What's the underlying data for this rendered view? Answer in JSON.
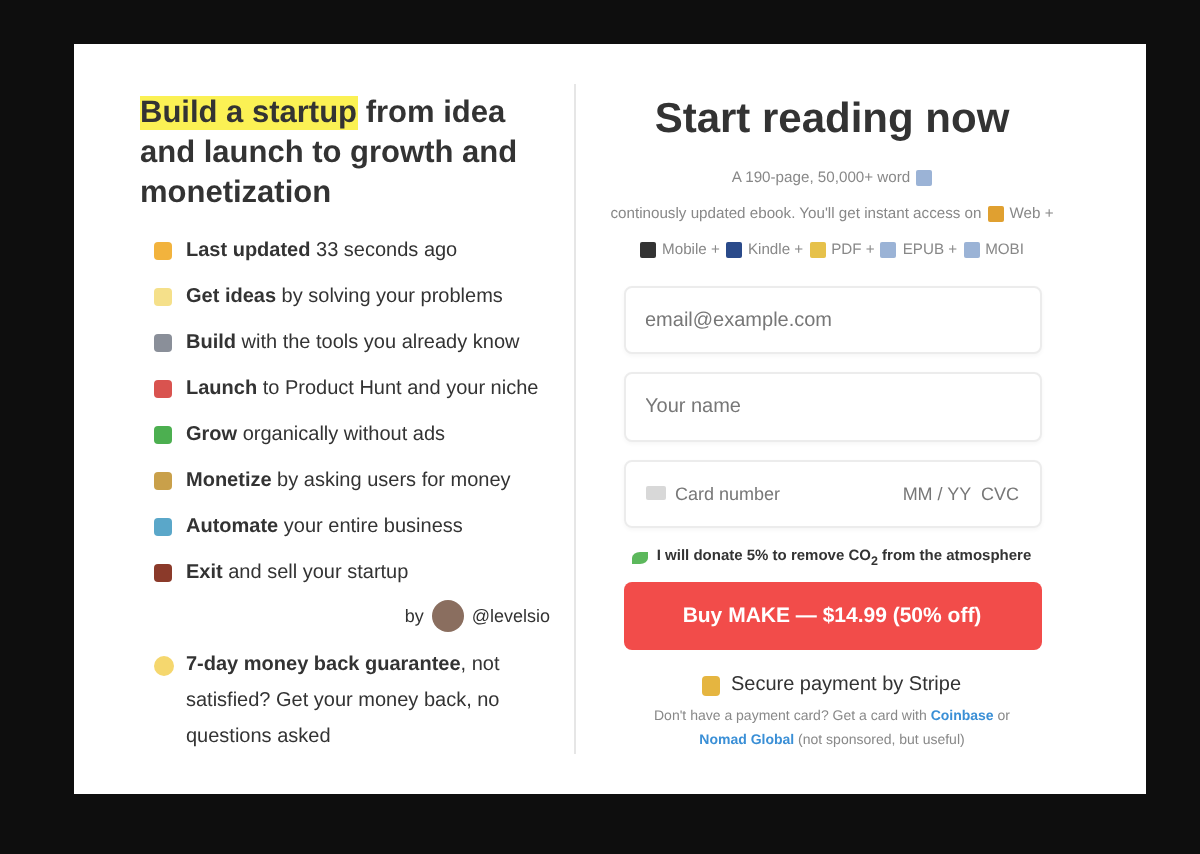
{
  "left": {
    "headline_highlight": "Build a startup",
    "headline_rest": "from idea and launch to growth and monetization",
    "features": [
      {
        "text": "**Last updated** 33 seconds ago"
      },
      {
        "text": "**Get ideas** by solving your problems"
      },
      {
        "text": "**Build** with the tools you already know"
      },
      {
        "text": "**Launch** to Product Hunt and your niche"
      },
      {
        "text": "**Grow** organically without ads"
      },
      {
        "text": "**Monetize** by asking users for money"
      },
      {
        "text": "**Automate** your entire business"
      },
      {
        "text": "**Exit** and sell your startup"
      }
    ],
    "byline": {
      "by": "by",
      "handle": "@levelsio"
    },
    "guarantee": "**7-day money back guarantee**, not satisfied? Get your money back, no questions asked"
  },
  "right": {
    "title": "Start reading now",
    "description": [
      "A 190-page, 50,000+ word",
      "continously updated ebook. You'll get instant access on",
      "Web +",
      "Mobile +",
      "Kindle +",
      "PDF +",
      "EPUB +",
      "MOBI"
    ],
    "email": {
      "placeholder": "email@example.com"
    },
    "name": {
      "placeholder": "Your name"
    },
    "card": {
      "placeholder": "Card number",
      "expiry_cvc": "MM / YY  CVC"
    },
    "donation": "I will donate 5% to remove CO$_{2}$ from the atmosphere",
    "buy_button": "Buy MAKE — $14.99 (50% off)",
    "secure": "Secure payment by Stripe",
    "footer": {
      "before": "Don't have a payment card? Get a card with",
      "link1": "Coinbase",
      "middle": "or",
      "link2": "Nomad Global",
      "after": "(not sponsored, but useful)"
    }
  }
}
